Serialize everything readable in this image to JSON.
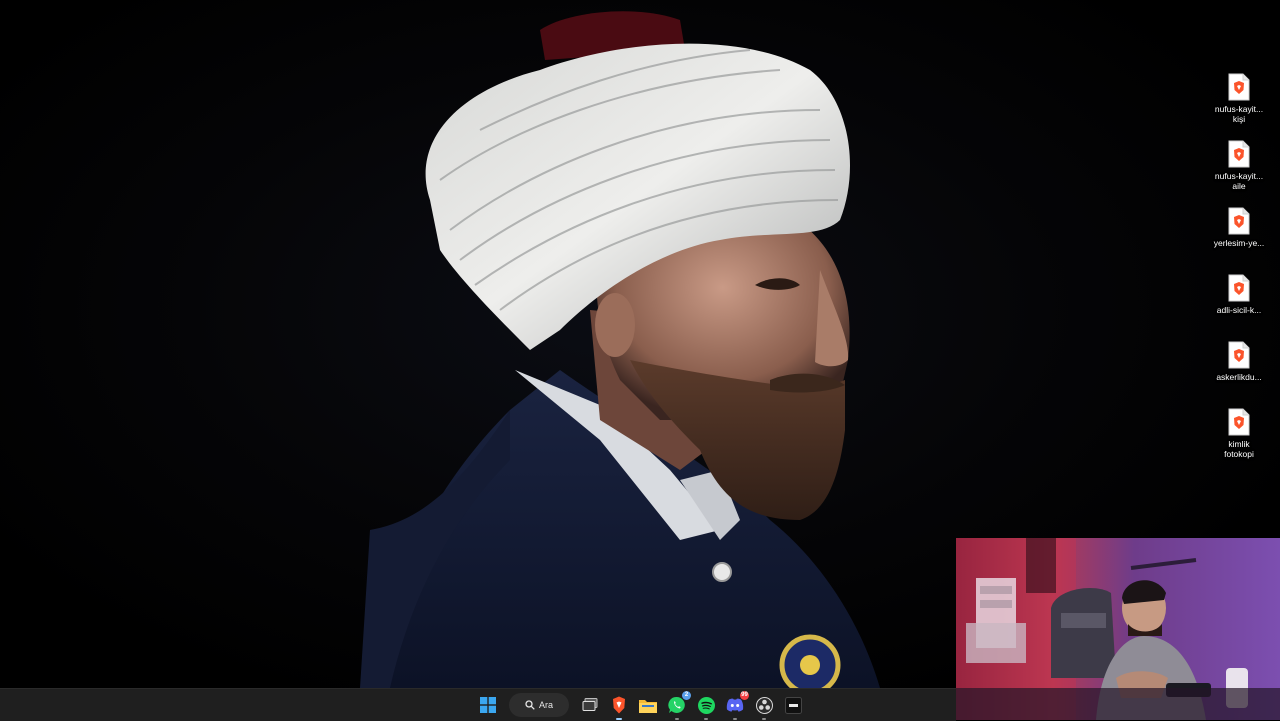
{
  "desktop": {
    "wallpaper_subject": "portrait-turban-wallpaper",
    "icons": [
      {
        "label": "nufus-kayit...\nkişi",
        "icon": "brave-html-file-icon"
      },
      {
        "label": "nufus-kayit...\naile",
        "icon": "brave-html-file-icon"
      },
      {
        "label": "yerlesim-ye...",
        "icon": "brave-html-file-icon"
      },
      {
        "label": "adli-sicil-k...",
        "icon": "brave-html-file-icon"
      },
      {
        "label": "askerlikdu...",
        "icon": "brave-html-file-icon"
      },
      {
        "label": "kimlik\nfotokopi",
        "icon": "brave-html-file-icon"
      }
    ]
  },
  "taskbar": {
    "search_label": "Ara",
    "apps": [
      {
        "name": "start-button",
        "icon": "windows-logo-icon"
      },
      {
        "name": "task-view",
        "icon": "task-view-icon"
      },
      {
        "name": "brave-browser",
        "icon": "brave-icon",
        "state": "active"
      },
      {
        "name": "file-explorer",
        "icon": "folder-icon"
      },
      {
        "name": "whatsapp",
        "icon": "whatsapp-icon",
        "badge": "2",
        "state": "running"
      },
      {
        "name": "spotify",
        "icon": "spotify-icon",
        "state": "running"
      },
      {
        "name": "discord",
        "icon": "discord-icon",
        "badge": "99",
        "state": "running"
      },
      {
        "name": "obs",
        "icon": "obs-icon",
        "state": "running"
      },
      {
        "name": "app",
        "icon": "dark-app-icon"
      }
    ]
  },
  "colors": {
    "taskbar_bg": "#1f1f1f",
    "brave_orange": "#fb542b",
    "whatsapp_green": "#25d366",
    "spotify_green": "#1ed760",
    "discord_blurple": "#5865f2"
  }
}
